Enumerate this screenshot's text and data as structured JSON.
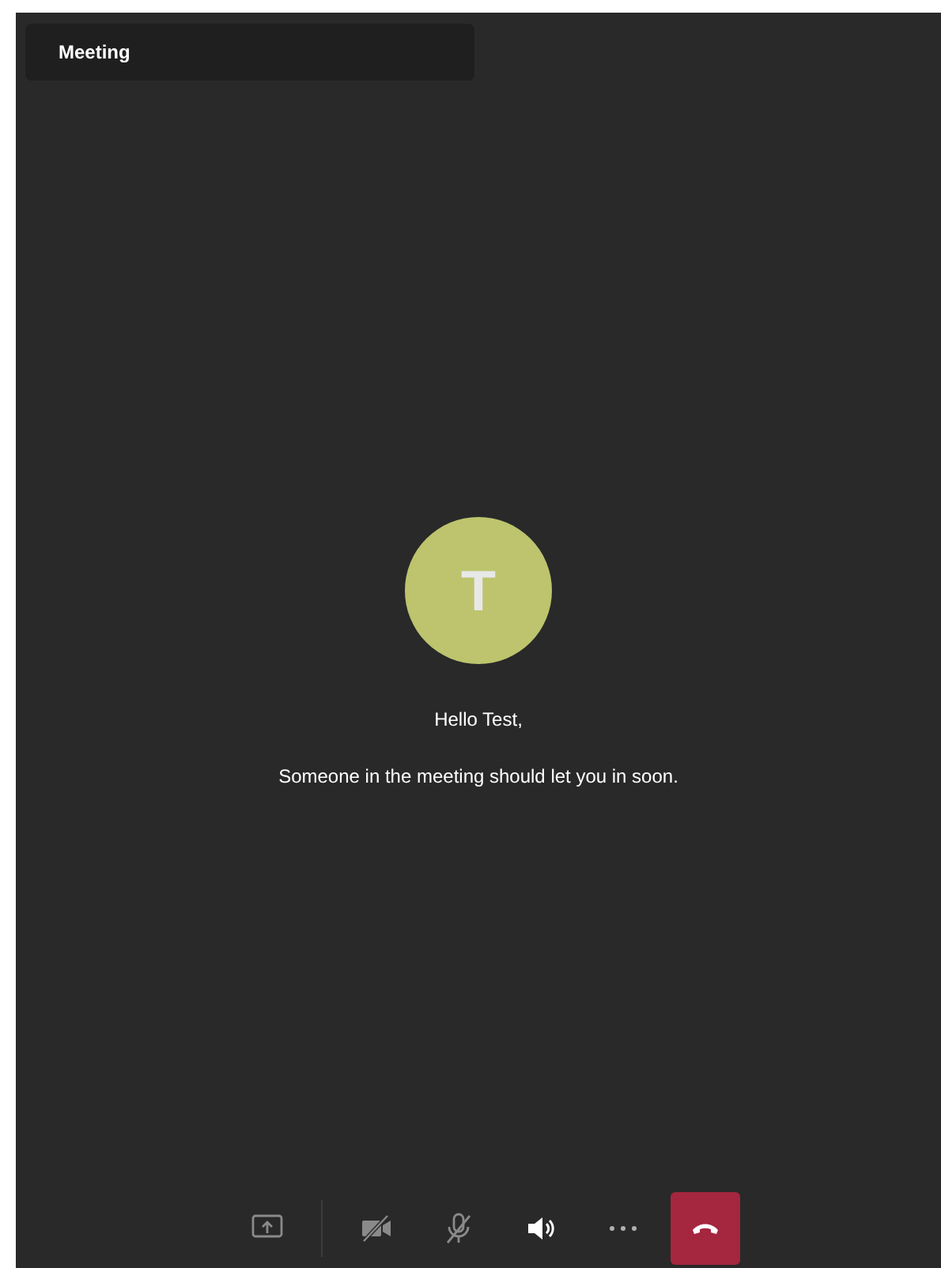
{
  "header": {
    "title": "Meeting"
  },
  "lobby": {
    "avatar_initial": "T",
    "greeting": "Hello Test,",
    "message": "Someone in the meeting should let you in soon."
  },
  "controls": [
    {
      "kind": "share",
      "disabled": true
    },
    {
      "kind": "camera",
      "disabled": true
    },
    {
      "kind": "mic",
      "disabled": true
    },
    {
      "kind": "speaker",
      "disabled": false
    },
    {
      "kind": "more",
      "disabled": false
    },
    {
      "kind": "hangup",
      "disabled": false
    }
  ]
}
